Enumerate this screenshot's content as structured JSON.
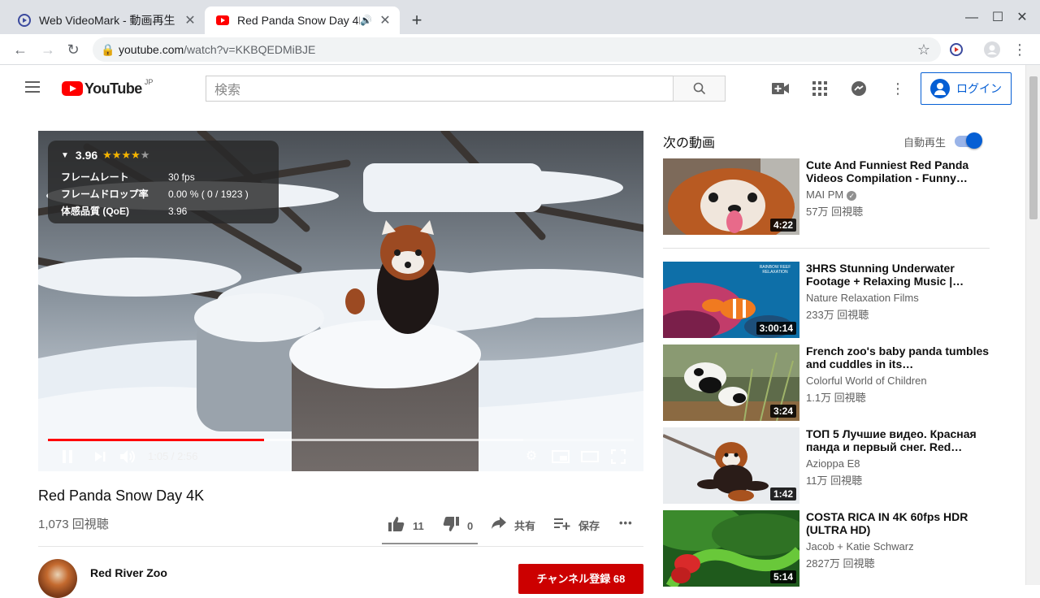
{
  "browser": {
    "tabs": [
      {
        "title": "Web VideoMark - 動画再生",
        "icon": "videomark-icon"
      },
      {
        "title": "Red Panda Snow Day 4K",
        "icon": "youtube-icon",
        "audio": "🔊"
      }
    ],
    "new_tab": "+",
    "url_host": "youtube.com",
    "url_path": "/watch?v=KKBQEDMiBJE"
  },
  "header": {
    "logo_text": "YouTube",
    "logo_region": "JP",
    "search_placeholder": "検索",
    "login_label": "ログイン"
  },
  "player": {
    "qoe": {
      "score": "3.96",
      "stars_on": "★★★★",
      "stars_off": "★",
      "rows": [
        {
          "label": "フレームレート",
          "value": "30 fps"
        },
        {
          "label": "フレームドロップ率",
          "value": "0.00 % ( 0 / 1923 )"
        },
        {
          "label": "体感品質 (QoE)",
          "value": "3.96"
        }
      ]
    },
    "time_current": "1:05",
    "time_total": "2:56",
    "timecode": "1:05 / 2:56",
    "progress_fraction": 0.3693,
    "buffered_fraction": 0.812
  },
  "video": {
    "title": "Red Panda Snow Day 4K",
    "views": "1,073 回視聴",
    "likes": "11",
    "dislikes": "0",
    "share_label": "共有",
    "save_label": "保存",
    "more": "•••"
  },
  "channel": {
    "name": "Red River Zoo",
    "subscribe_label": "チャンネル登録 68"
  },
  "sidebar": {
    "next_label": "次の動画",
    "autoplay_label": "自動再生",
    "autoplay_on": true,
    "videos": [
      {
        "title": "Cute And Funniest Red Panda Videos Compilation - Funny…",
        "channel": "MAI PM",
        "verified": true,
        "views": "57万 回視聴",
        "duration": "4:22"
      },
      {
        "title": "3HRS Stunning Underwater Footage + Relaxing Music |…",
        "channel": "Nature Relaxation Films",
        "verified": false,
        "views": "233万 回視聴",
        "duration": "3:00:14",
        "thumb_text": "RAINBOW REEF RELAXATION"
      },
      {
        "title": "French zoo's baby panda tumbles and cuddles in its…",
        "channel": "Colorful World of Children",
        "verified": false,
        "views": "1.1万 回視聴",
        "duration": "3:24"
      },
      {
        "title": "ТОП 5 Лучшие видео. Красная панда и первый снег. Red…",
        "channel": "Azioppa E8",
        "verified": false,
        "views": "11万 回視聴",
        "duration": "1:42"
      },
      {
        "title": "COSTA RICA IN 4K 60fps HDR (ULTRA HD)",
        "channel": "Jacob + Katie Schwarz",
        "verified": false,
        "views": "2827万 回視聴",
        "duration": "5:14"
      }
    ]
  }
}
